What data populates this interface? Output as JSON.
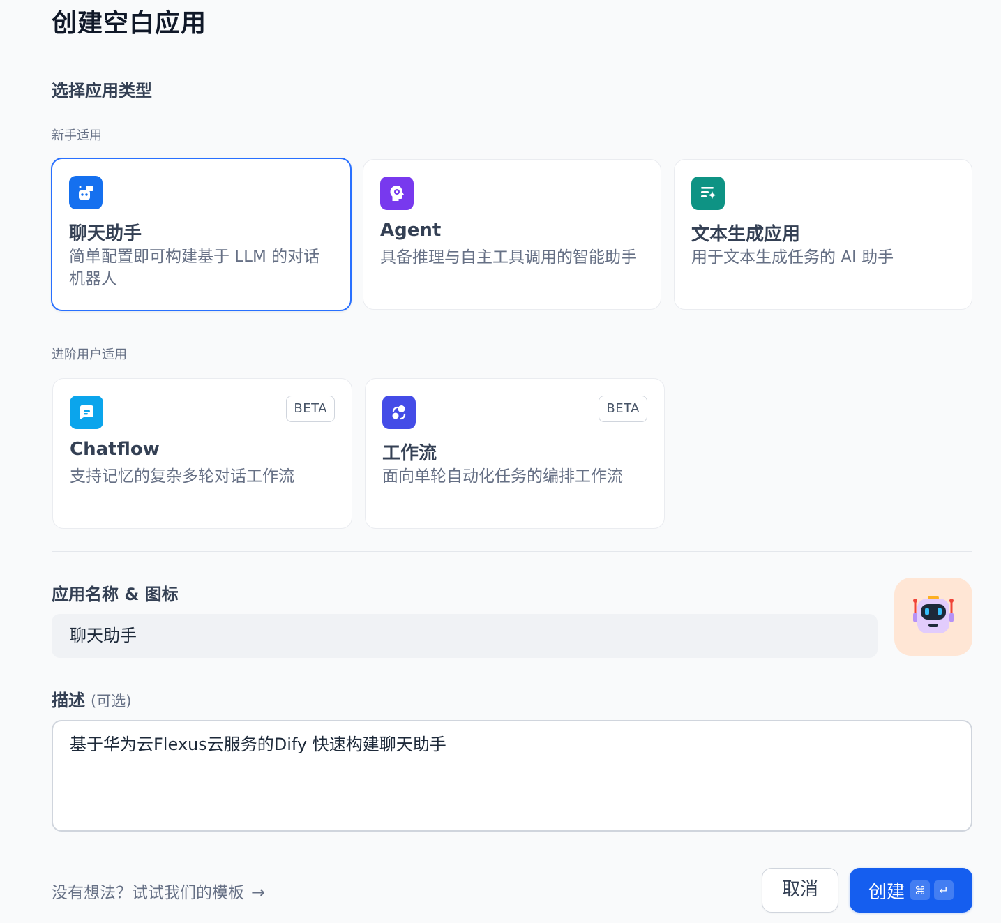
{
  "page_title": "创建空白应用",
  "section_title": "选择应用类型",
  "groups": {
    "beginner": "新手适用",
    "advanced": "进阶用户适用"
  },
  "cards": [
    {
      "title": "聊天助手",
      "desc": "简单配置即可构建基于 LLM 的对话机器人",
      "icon": "chat-bot-icon",
      "color": "#1570ef",
      "selected": true
    },
    {
      "title": "Agent",
      "desc": "具备推理与自主工具调用的智能助手",
      "icon": "agent-head-icon",
      "color": "#7839ee"
    },
    {
      "title": "文本生成应用",
      "desc": "用于文本生成任务的 AI 助手",
      "icon": "text-generation-icon",
      "color": "#0e9384"
    },
    {
      "title": "Chatflow",
      "desc": "支持记忆的复杂多轮对话工作流",
      "icon": "chatflow-icon",
      "color": "#0ba5ec",
      "badge": "BETA"
    },
    {
      "title": "工作流",
      "desc": "面向单轮自动化任务的编排工作流",
      "icon": "workflow-icon",
      "color": "#444ce7",
      "badge": "BETA"
    }
  ],
  "name_label": "应用名称 & 图标",
  "name_value": "聊天助手",
  "app_icon": "robot-emoji-icon",
  "desc_label": "描述",
  "desc_optional": "(可选)",
  "desc_value": "基于华为云Flexus云服务的Dify 快速构建聊天助手",
  "template_link": "没有想法？试试我们的模板",
  "cancel_label": "取消",
  "create_label": "创建",
  "shortcut_keys": [
    "⌘",
    "↵"
  ]
}
